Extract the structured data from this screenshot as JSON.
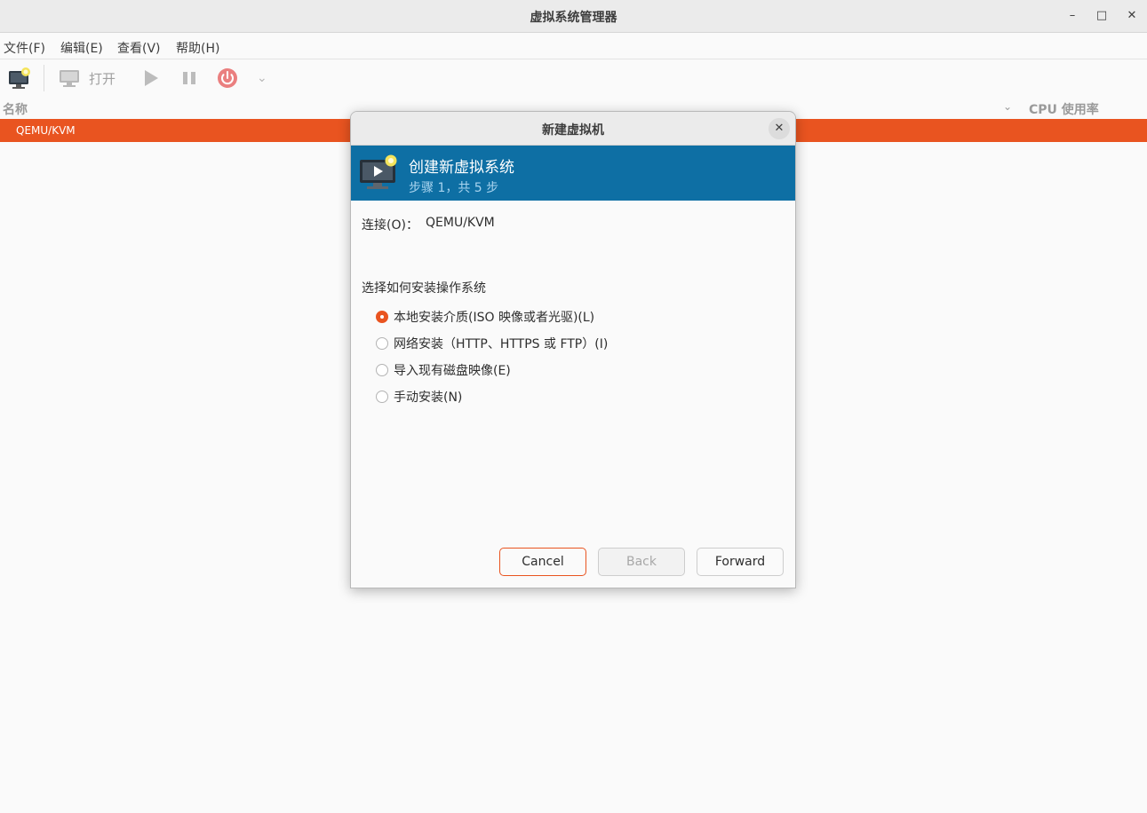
{
  "window": {
    "title": "虚拟系统管理器",
    "minimize_glyph": "–",
    "maximize_glyph": "□",
    "close_glyph": "✕"
  },
  "menu": [
    "文件(F)",
    "编辑(E)",
    "查看(V)",
    "帮助(H)"
  ],
  "toolbar": {
    "new_vm_icon": "new-vm-icon",
    "open_icon": "monitor-icon",
    "open_label": "打开",
    "run_icon": "play-icon",
    "pause_icon": "pause-icon",
    "shutdown_icon": "power-icon",
    "dropdown_glyph": "⌄"
  },
  "list": {
    "col_name": "名称",
    "col_sort_glyph": "⌄",
    "col_cpu": "CPU 使用率",
    "selected_row": "QEMU/KVM"
  },
  "dialog": {
    "title": "新建虚拟机",
    "close_glyph": "✕",
    "banner_title": "创建新虚拟系统",
    "banner_subtitle": "步骤 1，共 5 步",
    "connection_label": "连接(O)：",
    "connection_value": "QEMU/KVM",
    "section_label": "选择如何安装操作系统",
    "options": [
      {
        "label": "本地安装介质(ISO 映像或者光驱)(L)",
        "selected": true
      },
      {
        "label": "网络安装（HTTP、HTTPS 或 FTP）(I)",
        "selected": false
      },
      {
        "label": "导入现有磁盘映像(E)",
        "selected": false
      },
      {
        "label": "手动安装(N)",
        "selected": false
      }
    ],
    "buttons": {
      "cancel": "Cancel",
      "back": "Back",
      "forward": "Forward"
    }
  },
  "colors": {
    "accent": "#e95420",
    "banner": "#0e6fa4"
  }
}
